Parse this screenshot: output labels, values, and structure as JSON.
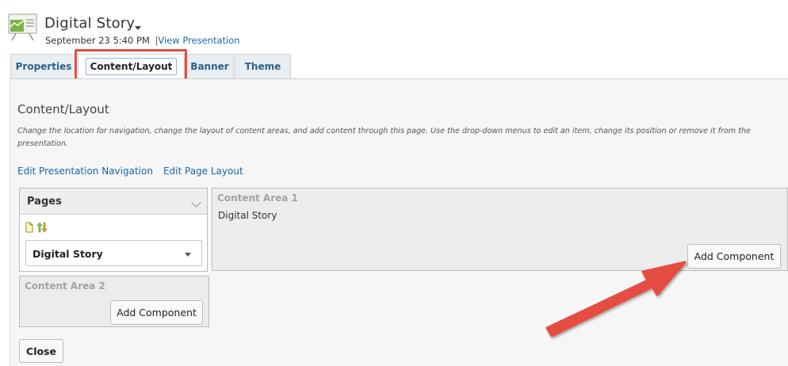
{
  "header": {
    "title": "Digital Story",
    "date": "September 23 5:40 PM",
    "separator": "|",
    "view_link": "View Presentation"
  },
  "tabs": [
    {
      "label": "Properties"
    },
    {
      "label": "Content/Layout",
      "active": true
    },
    {
      "label": "Banner"
    },
    {
      "label": "Theme"
    }
  ],
  "main": {
    "title": "Content/Layout",
    "description": "Change the location for navigation, change the layout of content areas, and add content through this page. Use the drop-down menus to edit an item, change its position or remove it from the presentation.",
    "nav_links": {
      "edit_navigation": "Edit Presentation Navigation",
      "edit_layout": "Edit Page Layout"
    }
  },
  "pages_panel": {
    "title": "Pages",
    "selected_page": "Digital Story"
  },
  "content_area_1": {
    "label": "Content Area 1",
    "item": "Digital Story",
    "add_button": "Add Component"
  },
  "content_area_2": {
    "label": "Content Area 2",
    "add_button": "Add Component"
  },
  "footer": {
    "close_button": "Close"
  },
  "colors": {
    "accent_link": "#1a66a8",
    "tab_text": "#2c5f87",
    "annotation_red": "#e54d42"
  }
}
